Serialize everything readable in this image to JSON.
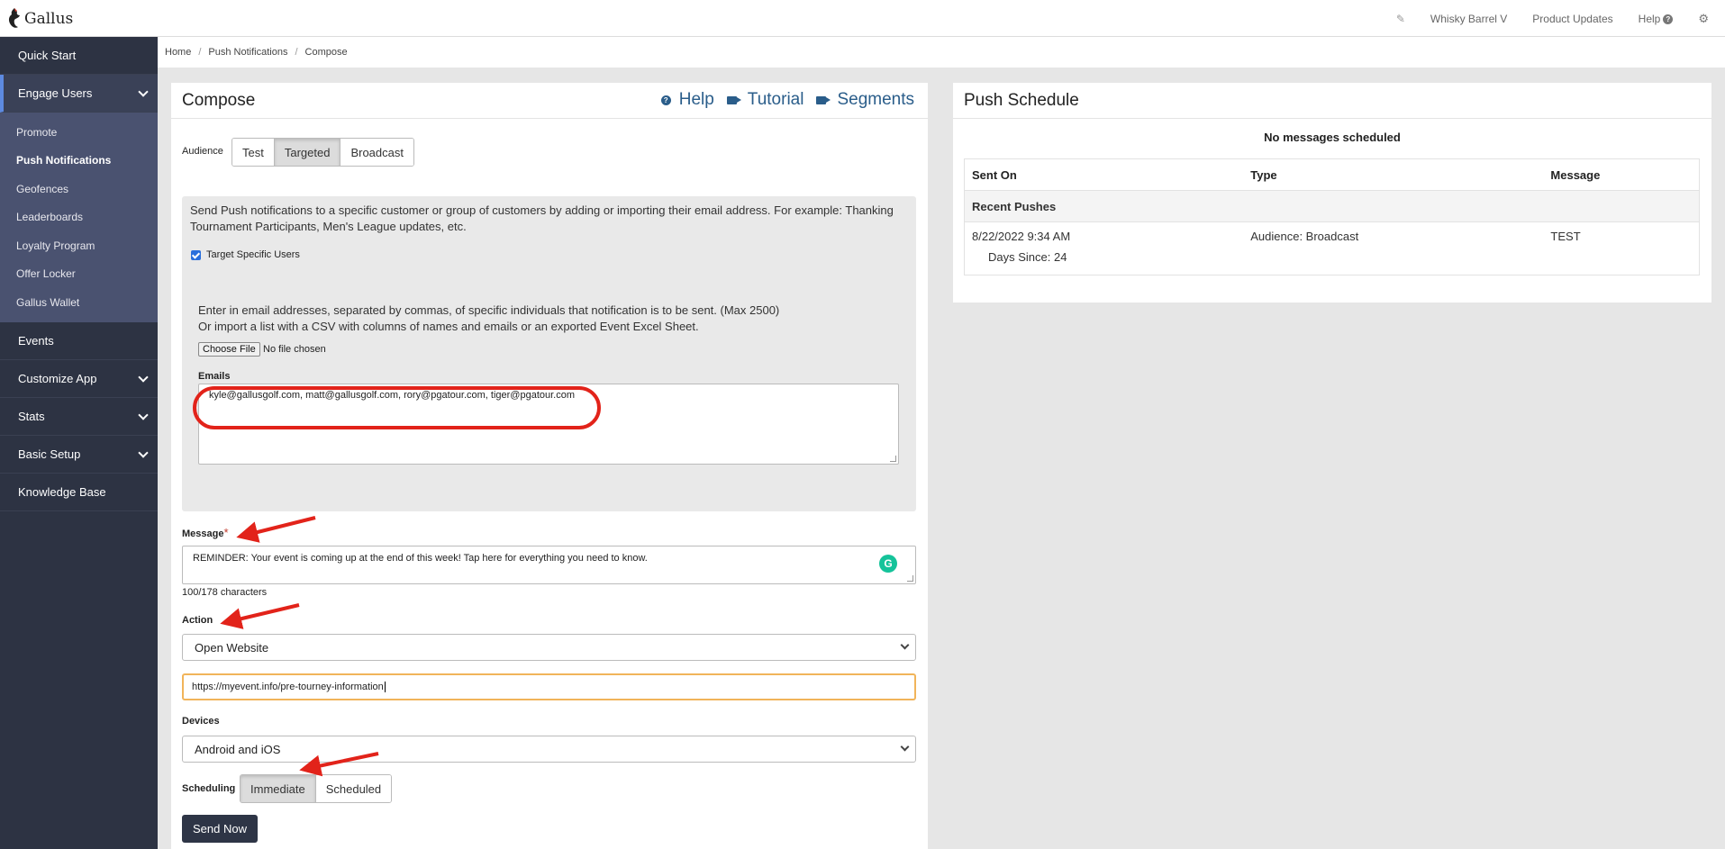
{
  "app": {
    "name": "Gallus"
  },
  "topnav": {
    "account": "Whisky Barrel V",
    "updates": "Product Updates",
    "help": "Help"
  },
  "sidebar": {
    "items": [
      {
        "label": "Quick Start"
      },
      {
        "label": "Engage Users"
      },
      {
        "label": "Events"
      },
      {
        "label": "Customize App"
      },
      {
        "label": "Stats"
      },
      {
        "label": "Basic Setup"
      },
      {
        "label": "Knowledge Base"
      }
    ],
    "sub": [
      "Promote",
      "Push Notifications",
      "Geofences",
      "Leaderboards",
      "Loyalty Program",
      "Offer Locker",
      "Gallus Wallet"
    ]
  },
  "breadcrumb": [
    "Home",
    "Push Notifications",
    "Compose"
  ],
  "compose": {
    "title": "Compose",
    "links": [
      "Help",
      "Tutorial",
      "Segments"
    ],
    "audience_label": "Audience",
    "audience_options": [
      "Test",
      "Targeted",
      "Broadcast"
    ],
    "audience_selected": "Targeted",
    "info": "Send Push notifications to a specific customer or group of customers by adding or importing their email address. For example: Thanking Tournament Participants, Men's League updates, etc.",
    "target_label": "Target Specific Users",
    "target_checked": true,
    "email_help_1": "Enter in email addresses, separated by commas, of specific individuals that notification is to be sent. (Max 2500)",
    "email_help_2": "Or import a list with a CSV with columns of names and emails or an exported Event Excel Sheet.",
    "file_button": "Choose File",
    "file_status": "No file chosen",
    "emails_label": "Emails",
    "emails_value": "kyle@gallusgolf.com, matt@gallusgolf.com, rory@pgatour.com, tiger@pgatour.com",
    "message_label": "Message",
    "message_required": "*",
    "message_value": "REMINDER: Your event is coming up at the end of this week! Tap here for everything you need to know.",
    "char_count": "100/178 characters",
    "action_label": "Action",
    "action_value": "Open Website",
    "url_value": "https://myevent.info/pre-tourney-information",
    "devices_label": "Devices",
    "devices_value": "Android and iOS",
    "scheduling_label": "Scheduling",
    "scheduling_options": [
      "Immediate",
      "Scheduled"
    ],
    "scheduling_selected": "Immediate",
    "send_button": "Send Now"
  },
  "schedule": {
    "title": "Push Schedule",
    "empty_text": "No messages scheduled",
    "columns": [
      "Sent On",
      "Type",
      "Message"
    ],
    "section": "Recent Pushes",
    "rows": [
      {
        "sent_on": "8/22/2022 9:34 AM",
        "days_since": "Days Since: 24",
        "type": "Audience: Broadcast",
        "message": "TEST"
      }
    ]
  },
  "colors": {
    "sidebar_bg": "#2d3343",
    "sidebar_sub_bg": "#4a5270",
    "link": "#2a5d8a",
    "annotation": "#e2231a",
    "focus": "#f1b45a"
  }
}
